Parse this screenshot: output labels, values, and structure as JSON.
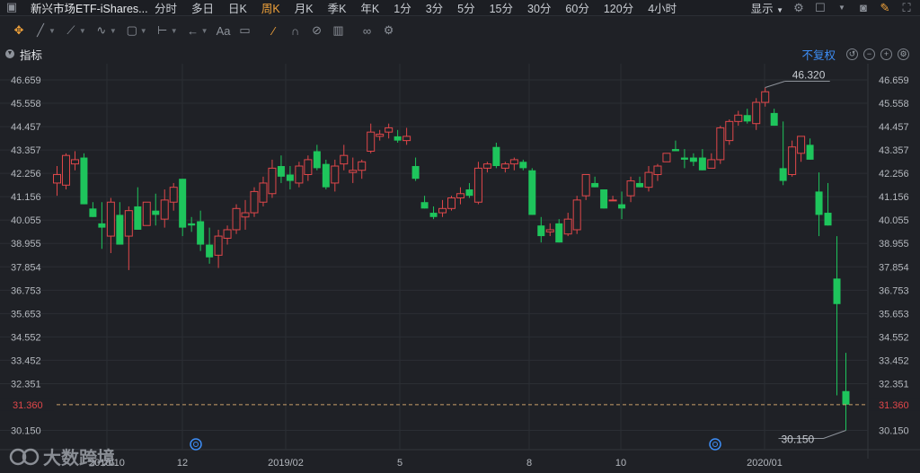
{
  "toolbar_top": {
    "title": "新兴市场ETF-iShares...",
    "intervals": [
      "分时",
      "多日",
      "日K",
      "周K",
      "月K",
      "季K",
      "年K",
      "1分",
      "3分",
      "5分",
      "15分",
      "30分",
      "60分",
      "120分",
      "4小时"
    ],
    "active_interval": "周K",
    "display_label": "显示"
  },
  "indicator_bar": {
    "label": "指标",
    "adjust_label": "不复权"
  },
  "colors": {
    "up": "#e0474a",
    "down": "#1ec55c",
    "accent": "#f0a23b",
    "link": "#3d8df5"
  },
  "watermark": {
    "text": "大数跨境"
  },
  "chart_data": {
    "type": "candlestick",
    "title": "",
    "xlabel": "",
    "ylabel": "",
    "ylim": [
      29.6,
      47.2
    ],
    "y_ticks": [
      46.659,
      45.558,
      44.457,
      43.357,
      42.256,
      41.156,
      40.055,
      38.955,
      37.854,
      36.753,
      35.653,
      34.552,
      33.452,
      32.351,
      30.15
    ],
    "x_labels": [
      "2018/10",
      "12",
      "2019/02",
      "5",
      "8",
      "10",
      "2020/01"
    ],
    "last_price": 31.36,
    "max_label": "46.320",
    "min_label": "30.150",
    "candles": [
      {
        "o": 41.8,
        "h": 42.6,
        "l": 41.2,
        "c": 42.2
      },
      {
        "o": 41.7,
        "h": 43.2,
        "l": 41.5,
        "c": 43.1
      },
      {
        "o": 42.7,
        "h": 43.3,
        "l": 42.4,
        "c": 42.9
      },
      {
        "o": 43.0,
        "h": 43.2,
        "l": 40.8,
        "c": 40.8
      },
      {
        "o": 40.6,
        "h": 40.9,
        "l": 40.2,
        "c": 40.2
      },
      {
        "o": 39.9,
        "h": 40.9,
        "l": 38.7,
        "c": 39.7
      },
      {
        "o": 39.3,
        "h": 41.1,
        "l": 38.5,
        "c": 40.9
      },
      {
        "o": 40.3,
        "h": 40.9,
        "l": 38.9,
        "c": 38.9
      },
      {
        "o": 39.3,
        "h": 40.7,
        "l": 37.7,
        "c": 40.5
      },
      {
        "o": 40.7,
        "h": 41.6,
        "l": 39.6,
        "c": 39.6
      },
      {
        "o": 39.8,
        "h": 40.9,
        "l": 39.8,
        "c": 40.9
      },
      {
        "o": 40.5,
        "h": 41.3,
        "l": 39.8,
        "c": 40.3
      },
      {
        "o": 40.1,
        "h": 41.5,
        "l": 39.7,
        "c": 41.0
      },
      {
        "o": 40.9,
        "h": 41.8,
        "l": 40.5,
        "c": 41.6
      },
      {
        "o": 42.0,
        "h": 42.0,
        "l": 39.3,
        "c": 39.7
      },
      {
        "o": 39.9,
        "h": 40.2,
        "l": 39.5,
        "c": 39.8
      },
      {
        "o": 40.0,
        "h": 40.5,
        "l": 38.6,
        "c": 38.9
      },
      {
        "o": 38.9,
        "h": 39.7,
        "l": 38.0,
        "c": 38.3
      },
      {
        "o": 38.4,
        "h": 39.6,
        "l": 37.8,
        "c": 39.3
      },
      {
        "o": 39.2,
        "h": 39.8,
        "l": 38.9,
        "c": 39.6
      },
      {
        "o": 39.6,
        "h": 40.8,
        "l": 39.4,
        "c": 40.6
      },
      {
        "o": 40.2,
        "h": 41.0,
        "l": 39.6,
        "c": 40.4
      },
      {
        "o": 40.4,
        "h": 41.6,
        "l": 40.2,
        "c": 41.4
      },
      {
        "o": 40.9,
        "h": 42.1,
        "l": 40.7,
        "c": 41.8
      },
      {
        "o": 41.3,
        "h": 42.9,
        "l": 41.1,
        "c": 42.5
      },
      {
        "o": 42.6,
        "h": 43.1,
        "l": 41.8,
        "c": 42.1
      },
      {
        "o": 42.2,
        "h": 42.6,
        "l": 41.5,
        "c": 41.9
      },
      {
        "o": 41.8,
        "h": 42.8,
        "l": 41.6,
        "c": 42.6
      },
      {
        "o": 42.2,
        "h": 43.1,
        "l": 41.9,
        "c": 42.9
      },
      {
        "o": 43.3,
        "h": 43.6,
        "l": 42.4,
        "c": 42.5
      },
      {
        "o": 42.7,
        "h": 42.9,
        "l": 41.5,
        "c": 41.6
      },
      {
        "o": 41.8,
        "h": 42.9,
        "l": 41.4,
        "c": 42.6
      },
      {
        "o": 42.7,
        "h": 43.6,
        "l": 42.4,
        "c": 43.1
      },
      {
        "o": 42.3,
        "h": 43.0,
        "l": 41.8,
        "c": 42.4
      },
      {
        "o": 42.4,
        "h": 42.9,
        "l": 42.0,
        "c": 42.8
      },
      {
        "o": 43.3,
        "h": 44.6,
        "l": 43.2,
        "c": 44.2
      },
      {
        "o": 44.0,
        "h": 44.3,
        "l": 43.8,
        "c": 44.1
      },
      {
        "o": 44.2,
        "h": 44.6,
        "l": 43.9,
        "c": 44.4
      },
      {
        "o": 44.0,
        "h": 44.3,
        "l": 43.7,
        "c": 43.8
      },
      {
        "o": 43.8,
        "h": 44.4,
        "l": 43.6,
        "c": 44.0
      },
      {
        "o": 42.6,
        "h": 43.0,
        "l": 41.9,
        "c": 42.0
      },
      {
        "o": 40.9,
        "h": 41.2,
        "l": 40.6,
        "c": 40.6
      },
      {
        "o": 40.4,
        "h": 40.7,
        "l": 40.1,
        "c": 40.2
      },
      {
        "o": 40.4,
        "h": 41.0,
        "l": 40.2,
        "c": 40.6
      },
      {
        "o": 40.6,
        "h": 41.2,
        "l": 40.5,
        "c": 41.1
      },
      {
        "o": 41.1,
        "h": 41.6,
        "l": 40.8,
        "c": 41.3
      },
      {
        "o": 41.5,
        "h": 41.8,
        "l": 41.1,
        "c": 41.2
      },
      {
        "o": 40.9,
        "h": 42.8,
        "l": 40.8,
        "c": 42.5
      },
      {
        "o": 42.5,
        "h": 42.8,
        "l": 42.3,
        "c": 42.7
      },
      {
        "o": 43.5,
        "h": 43.7,
        "l": 42.5,
        "c": 42.6
      },
      {
        "o": 42.5,
        "h": 42.8,
        "l": 42.3,
        "c": 42.7
      },
      {
        "o": 42.7,
        "h": 43.0,
        "l": 42.4,
        "c": 42.9
      },
      {
        "o": 42.8,
        "h": 42.9,
        "l": 42.4,
        "c": 42.5
      },
      {
        "o": 42.4,
        "h": 42.5,
        "l": 40.3,
        "c": 40.3
      },
      {
        "o": 39.8,
        "h": 40.2,
        "l": 39.0,
        "c": 39.3
      },
      {
        "o": 39.5,
        "h": 39.9,
        "l": 39.3,
        "c": 39.6
      },
      {
        "o": 39.9,
        "h": 40.1,
        "l": 39.0,
        "c": 39.0
      },
      {
        "o": 39.4,
        "h": 40.4,
        "l": 39.3,
        "c": 40.1
      },
      {
        "o": 39.6,
        "h": 41.2,
        "l": 39.4,
        "c": 41.0
      },
      {
        "o": 41.2,
        "h": 42.2,
        "l": 41.0,
        "c": 42.2
      },
      {
        "o": 41.8,
        "h": 42.1,
        "l": 41.6,
        "c": 41.6
      },
      {
        "o": 41.5,
        "h": 41.5,
        "l": 40.6,
        "c": 40.6
      },
      {
        "o": 41.0,
        "h": 41.2,
        "l": 41.0,
        "c": 41.0
      },
      {
        "o": 40.8,
        "h": 41.4,
        "l": 40.1,
        "c": 40.6
      },
      {
        "o": 41.2,
        "h": 42.1,
        "l": 40.9,
        "c": 41.9
      },
      {
        "o": 41.8,
        "h": 42.1,
        "l": 41.6,
        "c": 41.6
      },
      {
        "o": 41.6,
        "h": 42.6,
        "l": 41.4,
        "c": 42.3
      },
      {
        "o": 42.2,
        "h": 42.7,
        "l": 41.9,
        "c": 42.6
      },
      {
        "o": 42.8,
        "h": 43.2,
        "l": 42.8,
        "c": 43.2
      },
      {
        "o": 43.4,
        "h": 43.8,
        "l": 43.3,
        "c": 43.3
      },
      {
        "o": 43.0,
        "h": 43.4,
        "l": 42.5,
        "c": 42.9
      },
      {
        "o": 43.0,
        "h": 43.2,
        "l": 42.6,
        "c": 42.8
      },
      {
        "o": 43.0,
        "h": 43.4,
        "l": 42.4,
        "c": 42.4
      },
      {
        "o": 42.5,
        "h": 43.2,
        "l": 42.5,
        "c": 42.9
      },
      {
        "o": 42.9,
        "h": 44.5,
        "l": 42.7,
        "c": 44.4
      },
      {
        "o": 43.8,
        "h": 44.8,
        "l": 43.6,
        "c": 44.7
      },
      {
        "o": 44.7,
        "h": 45.2,
        "l": 44.5,
        "c": 45.0
      },
      {
        "o": 45.0,
        "h": 45.3,
        "l": 44.6,
        "c": 44.7
      },
      {
        "o": 44.6,
        "h": 45.8,
        "l": 44.3,
        "c": 45.6
      },
      {
        "o": 45.6,
        "h": 46.3,
        "l": 45.4,
        "c": 46.1
      },
      {
        "o": 45.1,
        "h": 45.3,
        "l": 44.5,
        "c": 44.5
      },
      {
        "o": 42.5,
        "h": 44.7,
        "l": 41.7,
        "c": 41.9
      },
      {
        "o": 42.2,
        "h": 43.8,
        "l": 42.1,
        "c": 43.5
      },
      {
        "o": 43.2,
        "h": 43.9,
        "l": 42.8,
        "c": 44.0
      },
      {
        "o": 43.6,
        "h": 43.9,
        "l": 42.9,
        "c": 42.9
      },
      {
        "o": 41.4,
        "h": 42.3,
        "l": 39.3,
        "c": 40.3
      },
      {
        "o": 40.4,
        "h": 41.8,
        "l": 39.8,
        "c": 39.8
      },
      {
        "o": 37.3,
        "h": 39.3,
        "l": 31.8,
        "c": 36.1
      },
      {
        "o": 32.0,
        "h": 33.8,
        "l": 30.15,
        "c": 31.36
      }
    ]
  }
}
